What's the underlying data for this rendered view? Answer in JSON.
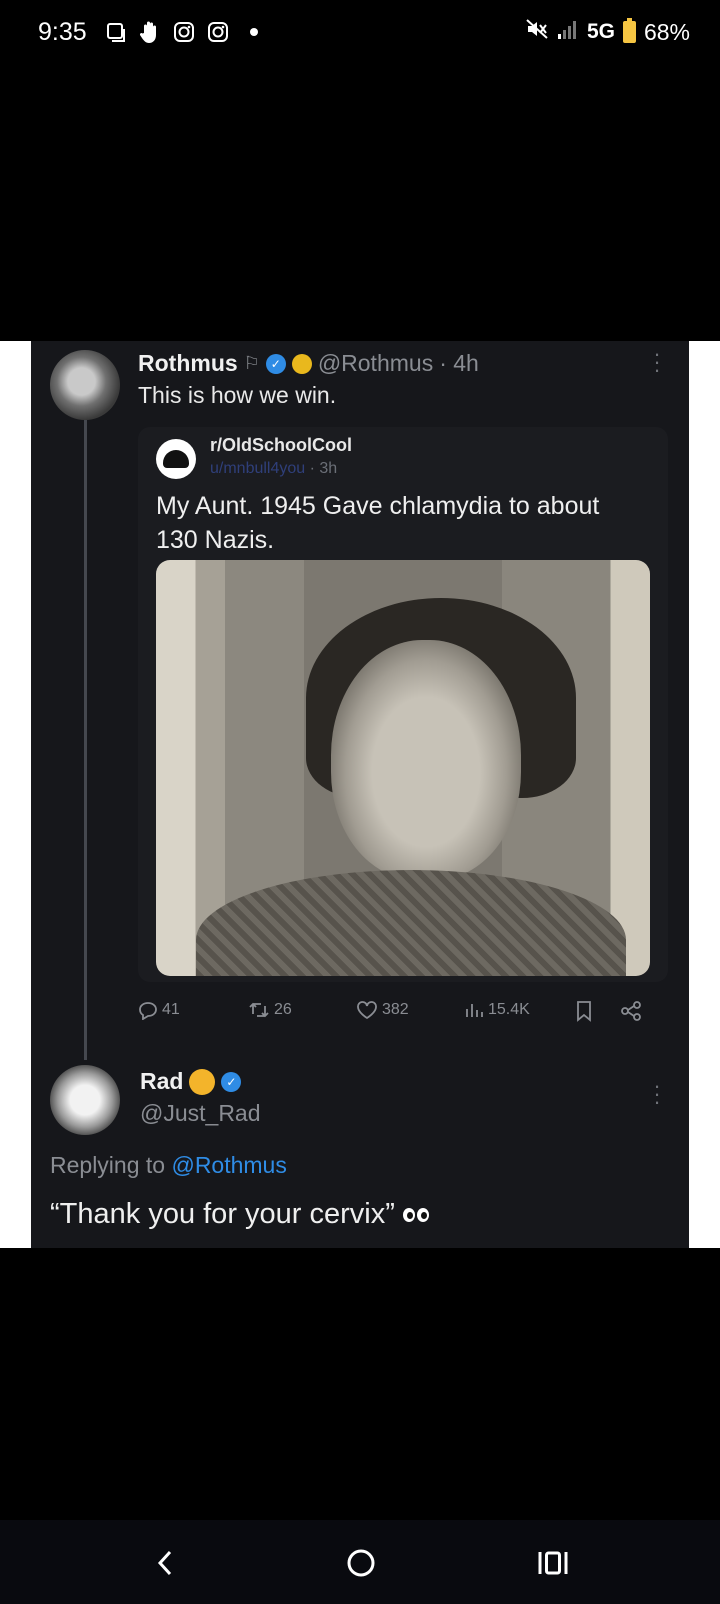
{
  "status_bar": {
    "time": "9:35",
    "network": "5G",
    "battery": "68%",
    "left_icons": [
      "screenshot-icon",
      "hand-icon",
      "instagram-icon",
      "instagram-icon",
      "dot-icon"
    ],
    "right_icons": [
      "mute-icon",
      "signal-icon",
      "battery-icon"
    ]
  },
  "post": {
    "author_name": "Rothmus",
    "author_handle": "@Rothmus",
    "time": "· 4h",
    "text": "This is how we win.",
    "quote": {
      "subreddit": "r/OldSchoolCool",
      "user": "u/mnbull4you",
      "time": "· 3h",
      "text": "My Aunt.  1945  Gave chlamydia to about 130 Nazis."
    },
    "actions": {
      "replies": "41",
      "reposts": "26",
      "likes": "382",
      "views": "15.4K"
    }
  },
  "reply": {
    "author_name": "Rad",
    "author_handle": "@Just_Rad",
    "replying_prefix": "Replying to ",
    "replying_to": "@Rothmus",
    "text": "“Thank you for your cervix”"
  },
  "colors": {
    "background": "#000000",
    "tweet_bg": "#16171b",
    "accent": "#2f8ce5",
    "muted": "#8a8d93",
    "battery": "#f5c542"
  }
}
